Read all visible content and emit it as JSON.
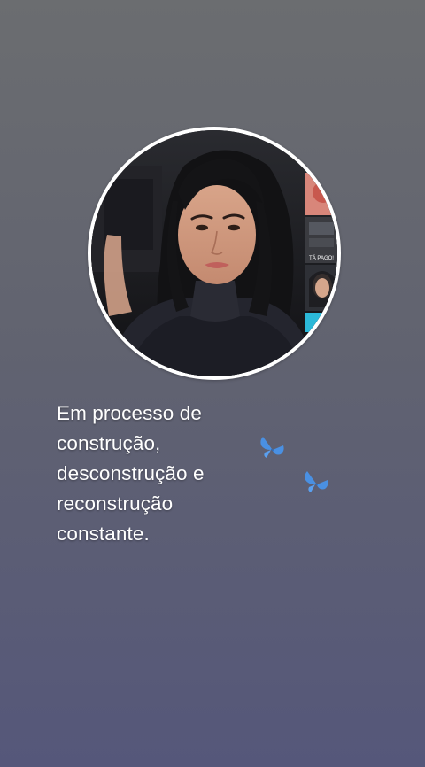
{
  "profile": {
    "avatar_icon": "profile-photo",
    "preview_label": "TÁ PAGO!"
  },
  "bio": {
    "lines": [
      "Em processo de",
      "construção,",
      "desconstrução e",
      "reconstrução",
      "constante."
    ]
  },
  "decorations": {
    "icon": "butterfly-icon",
    "color": "#4a90e2"
  },
  "colors": {
    "background_top": "#6b6d70",
    "background_bottom": "#55577a",
    "ring": "#ffffff",
    "text": "#ffffff"
  }
}
